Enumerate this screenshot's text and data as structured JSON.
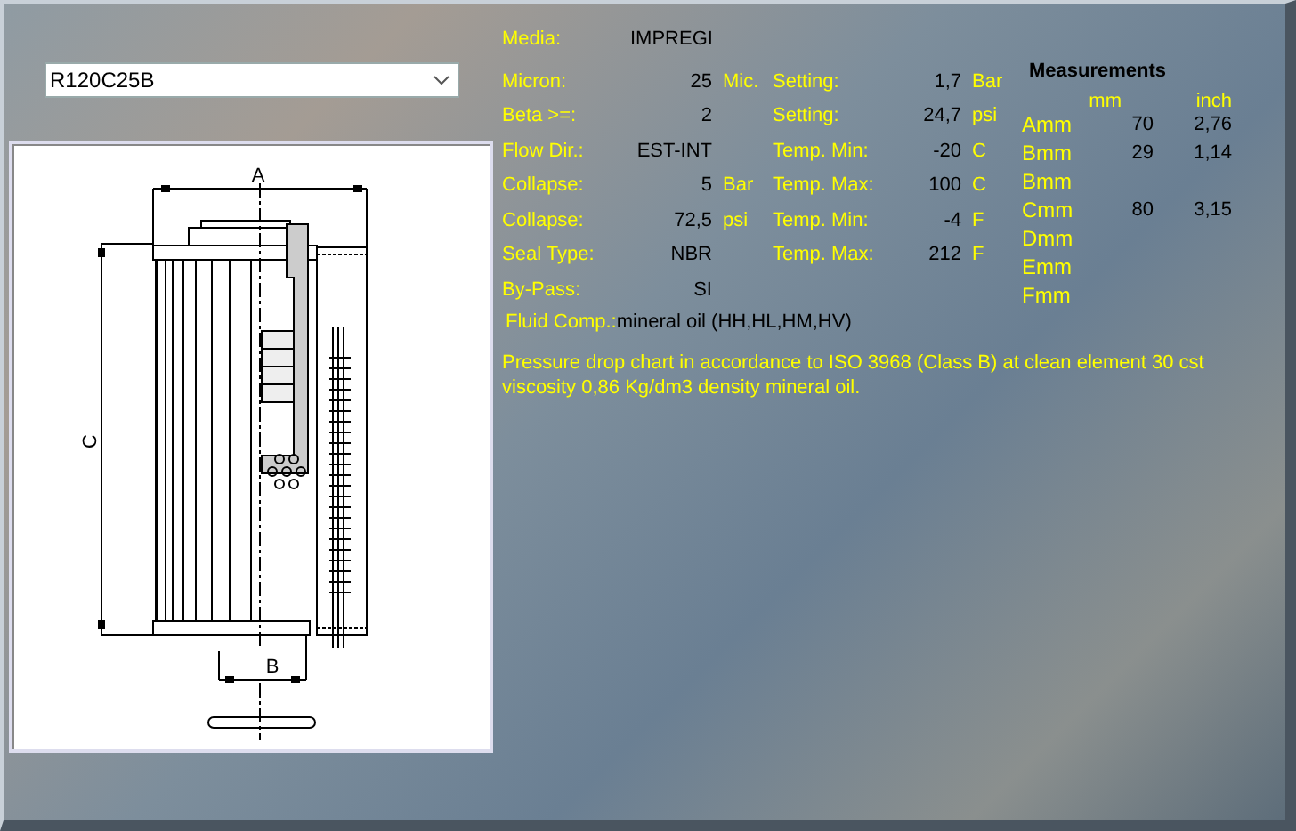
{
  "selector": {
    "value": "R120C25B"
  },
  "drawing": {
    "dimension_labels": [
      "A",
      "B",
      "C"
    ]
  },
  "media": {
    "label": "Media:",
    "value": "IMPREGI"
  },
  "left_specs": [
    {
      "label": "Micron:",
      "value": "25",
      "unit": "Mic."
    },
    {
      "label": "Beta >=:",
      "value": "2"
    },
    {
      "label": "Flow Dir.:",
      "value": "EST-INT"
    },
    {
      "label": "Collapse:",
      "value": "5",
      "unit": "Bar"
    },
    {
      "label": "Collapse:",
      "value": "72,5",
      "unit": "psi"
    },
    {
      "label": "Seal Type:",
      "value": "NBR"
    },
    {
      "label": "By-Pass:",
      "value": "SI"
    }
  ],
  "right_specs": [
    {
      "label": "Setting:",
      "value": "1,7",
      "unit": "Bar"
    },
    {
      "label": "Setting:",
      "value": "24,7",
      "unit": "psi"
    },
    {
      "label": "Temp. Min:",
      "value": "-20",
      "unit": "C"
    },
    {
      "label": "Temp. Max:",
      "value": "100",
      "unit": "C"
    },
    {
      "label": "Temp. Min:",
      "value": "-4",
      "unit": "F"
    },
    {
      "label": "Temp. Max:",
      "value": "212",
      "unit": "F"
    }
  ],
  "fluid": {
    "label": "Fluid Comp.:",
    "value": "mineral oil (HH,HL,HM,HV)"
  },
  "note": "Pressure drop chart in accordance to ISO 3968 (Class B) at clean element 30 cst viscosity 0,86 Kg/dm3 density mineral oil.",
  "measurements": {
    "title": "Measurements",
    "columns": [
      "mm",
      "inch"
    ],
    "rows": [
      {
        "label": "Amm",
        "mm": "70",
        "inch": "2,76"
      },
      {
        "label": "Bmm",
        "mm": "29",
        "inch": "1,14"
      },
      {
        "label": "Bmm"
      },
      {
        "label": "Cmm",
        "mm": "80",
        "inch": "3,15"
      },
      {
        "label": "Dmm"
      },
      {
        "label": "Emm"
      },
      {
        "label": "Fmm"
      }
    ]
  }
}
